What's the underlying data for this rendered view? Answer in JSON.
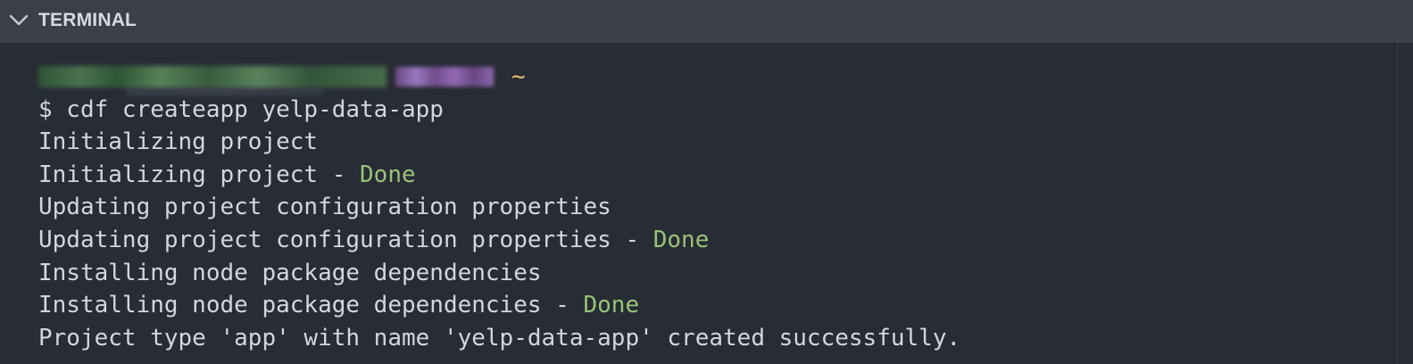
{
  "panel": {
    "title": "TERMINAL",
    "toggle_icon": "chevron-down-icon"
  },
  "terminal": {
    "prompt": {
      "user_host": "",
      "dir": "~"
    },
    "lines": [
      {
        "text": "$ cdf createapp yelp-data-app",
        "status": ""
      },
      {
        "text": "Initializing project",
        "status": ""
      },
      {
        "text": "Initializing project - ",
        "status": "Done"
      },
      {
        "text": "Updating project configuration properties",
        "status": ""
      },
      {
        "text": "Updating project configuration properties - ",
        "status": "Done"
      },
      {
        "text": "Installing node package dependencies",
        "status": ""
      },
      {
        "text": "Installing node package dependencies - ",
        "status": "Done"
      },
      {
        "text": "Project type 'app' with name 'yelp-data-app' created successfully.",
        "status": ""
      }
    ],
    "colors": {
      "background": "#282c34",
      "header_background": "#3b3f4a",
      "text": "#d3d7dd",
      "done": "#98c379",
      "tilde": "#e5c07b"
    }
  }
}
